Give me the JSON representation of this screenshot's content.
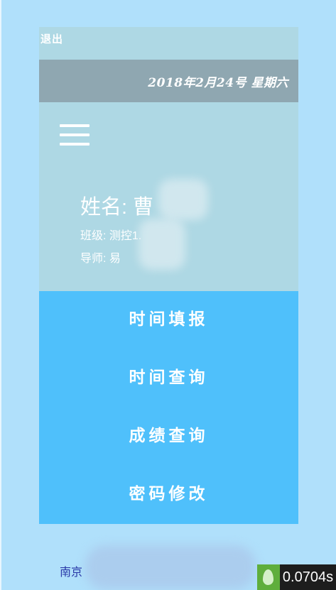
{
  "header": {
    "logout_label": "退出",
    "date": "2018年2月24号 星期六"
  },
  "profile": {
    "name_label": "姓名:",
    "name_value": "曹",
    "class_label": "班级:",
    "class_value": "测控1.",
    "advisor_label": "导师:",
    "advisor_value": "易"
  },
  "menu": {
    "items": [
      {
        "label": "时间填报"
      },
      {
        "label": "时间查询"
      },
      {
        "label": "成绩查询"
      },
      {
        "label": "密码修改"
      }
    ]
  },
  "footer": {
    "link_text": "南京",
    "timing": "0.0704s"
  },
  "icons": {
    "menu": "hamburger-menu-icon",
    "badge": "leaf-badge-icon"
  },
  "colors": {
    "page_bg": "#b0e0fb",
    "panel_bg": "#aed8e4",
    "date_bar_bg": "#8fa7b1",
    "menu_bg": "#4fc0fb"
  }
}
